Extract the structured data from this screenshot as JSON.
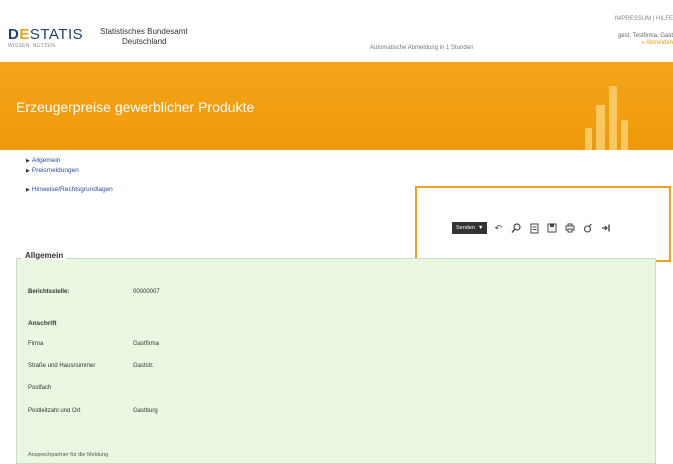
{
  "header": {
    "logo_d": "D",
    "logo_s": "E",
    "logo_rest": "STATIS",
    "logo_tagline": "WISSEN. NUTZEN.",
    "agency_line1": "Statistisches Bundesamt",
    "agency_line2": "Deutschland",
    "login_note": "Automatische Abmeldung in 1 Stunden",
    "right_top": "IMPRESSUM | HILFE",
    "right_user": "gest. Testfirma, Gast",
    "right_link": "» Abmelden"
  },
  "banner": {
    "title": "Erzeugerpreise gewerblicher Produkte",
    "bar_color": "#f9c860",
    "bg_color": "#ef9a0c"
  },
  "nav": {
    "items": [
      {
        "label": "Allgemein"
      },
      {
        "label": "Preismeldungen"
      },
      {
        "label": "Hinweise/Rechtsgrundlagen"
      }
    ]
  },
  "toolbar": {
    "select_label": "Senden",
    "icons": [
      "undo-icon",
      "search-icon",
      "document-icon",
      "save-icon",
      "print-icon",
      "attachment-icon",
      "logout-icon"
    ]
  },
  "panel": {
    "legend": "Allgemein",
    "berichtsstelle_label": "Berichtsstelle:",
    "berichtsstelle_value": "00000007",
    "anschrift_label": "Anschrift",
    "fields": [
      {
        "label": "Firma",
        "value": "Gastfirma"
      },
      {
        "label": "Straße und Hausnummer",
        "value": "Gaststr."
      },
      {
        "label": "Postfach",
        "value": ""
      },
      {
        "label": "Postleitzahl und Ort",
        "value": "Gastburg"
      }
    ],
    "footer_text": "Ansprechpartner für die Meldung"
  },
  "colors": {
    "accent": "#f0a21a",
    "panel_bg": "#eaf7e3",
    "link": "#2a4f9a"
  }
}
